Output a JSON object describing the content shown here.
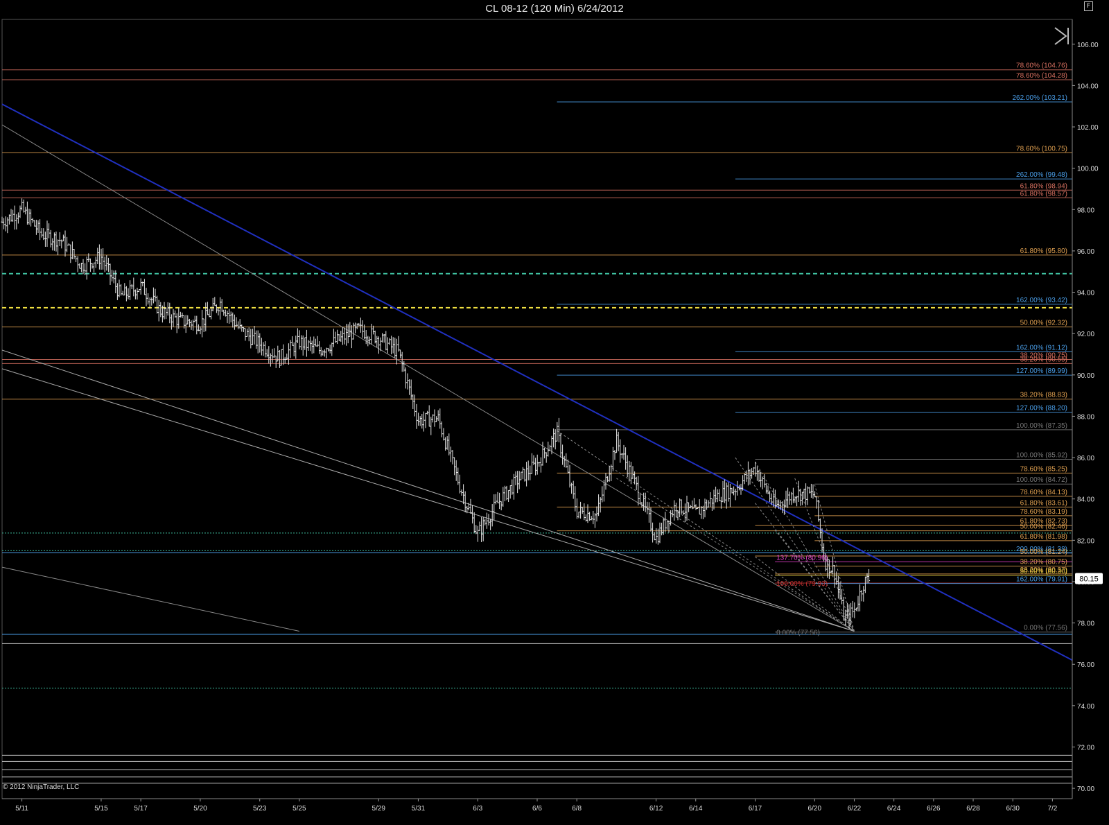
{
  "window": {
    "title": "CL 08-12 (120 Min)  6/24/2012",
    "f_button": "F"
  },
  "copyright": "© 2012 NinjaTrader, LLC",
  "chart_data": {
    "type": "ohlc_bar",
    "instrument": "CL 08-12",
    "interval": "120 Min",
    "ylim": [
      69.5,
      107.2
    ],
    "y_ticks": [
      106,
      104,
      102,
      100,
      98,
      96,
      94,
      92,
      90,
      88,
      86,
      84,
      82,
      80,
      78,
      76,
      74,
      72,
      70
    ],
    "y_tick_labels": [
      "106.00",
      "104.00",
      "102.00",
      "100.00",
      "98.00",
      "96.00",
      "94.00",
      "92.00",
      "90.00",
      "88.00",
      "86.00",
      "84.00",
      "82.00",
      "80.00",
      "78.00",
      "76.00",
      "74.00",
      "72.00",
      "70.00"
    ],
    "x_range": [
      "5/10",
      "7/3"
    ],
    "x_tick_dates": [
      "5/11",
      "5/15",
      "5/17",
      "5/20",
      "5/23",
      "5/25",
      "5/29",
      "5/31",
      "6/3",
      "6/6",
      "6/8",
      "6/12",
      "6/14",
      "6/17",
      "6/20",
      "6/22",
      "6/24",
      "6/26",
      "6/28",
      "6/30",
      "7/2"
    ],
    "x_tick_labels": [
      "5/11",
      "5/15",
      "5/17",
      "5/20",
      "5/23",
      "5/25",
      "5/29",
      "5/31",
      "6/3",
      "6/6",
      "6/8",
      "6/12",
      "6/14",
      "6/17",
      "6/20",
      "6/22",
      "6/24",
      "6/26",
      "6/28",
      "6/30",
      "7/2"
    ],
    "last_price": "80.15",
    "price_path": [
      [
        "5/10",
        97.4
      ],
      [
        "5/11",
        98.0
      ],
      [
        "5/12",
        96.8
      ],
      [
        "5/13",
        96.5
      ],
      [
        "5/14",
        95.3
      ],
      [
        "5/15",
        95.7
      ],
      [
        "5/16",
        93.8
      ],
      [
        "5/17",
        94.3
      ],
      [
        "5/18",
        93.1
      ],
      [
        "5/19",
        92.6
      ],
      [
        "5/20",
        92.5
      ],
      [
        "5/21",
        93.5
      ],
      [
        "5/22",
        92.2
      ],
      [
        "5/23",
        91.5
      ],
      [
        "5/24",
        90.8
      ],
      [
        "5/25",
        91.6
      ],
      [
        "5/26",
        91.2
      ],
      [
        "5/27",
        91.7
      ],
      [
        "5/28",
        92.2
      ],
      [
        "5/29",
        91.8
      ],
      [
        "5/30",
        91.1
      ],
      [
        "5/31",
        87.8
      ],
      [
        "6/1",
        87.9
      ],
      [
        "6/2",
        84.9
      ],
      [
        "6/3",
        82.3
      ],
      [
        "6/4",
        83.8
      ],
      [
        "6/5",
        84.9
      ],
      [
        "6/6",
        85.7
      ],
      [
        "6/7",
        87.2
      ],
      [
        "6/8",
        83.4
      ],
      [
        "6/9",
        83.2
      ],
      [
        "6/10",
        86.8
      ],
      [
        "6/11",
        84.6
      ],
      [
        "6/12",
        82.1
      ],
      [
        "6/13",
        83.7
      ],
      [
        "6/14",
        83.3
      ],
      [
        "6/15",
        84.1
      ],
      [
        "6/16",
        84.5
      ],
      [
        "6/17",
        85.5
      ],
      [
        "6/18",
        83.6
      ],
      [
        "6/19",
        84.3
      ],
      [
        "6/20",
        84.2
      ],
      [
        "6/20.5",
        81.0
      ],
      [
        "6/21",
        80.5
      ],
      [
        "6/21.5",
        78.2
      ],
      [
        "6/22",
        78.6
      ],
      [
        "6/22.5",
        80.0
      ],
      [
        "6/22.8",
        80.15
      ]
    ],
    "fib_levels": [
      {
        "label": "78.60% (104.76)",
        "price": 104.76,
        "color": "#d77060",
        "start": "left"
      },
      {
        "label": "78.60% (104.28)",
        "price": 104.28,
        "color": "#d77060",
        "start": "left"
      },
      {
        "label": "262.00% (103.21)",
        "price": 103.21,
        "color": "#4a9ee8",
        "start": "6/7"
      },
      {
        "label": "78.60% (100.75)",
        "price": 100.75,
        "color": "#e0a050",
        "start": "left"
      },
      {
        "label": "262.00% (99.48)",
        "price": 99.48,
        "color": "#4a9ee8",
        "start": "6/16"
      },
      {
        "label": "61.80% (98.94)",
        "price": 98.94,
        "color": "#d77060",
        "start": "left"
      },
      {
        "label": "61.80% (98.57)",
        "price": 98.57,
        "color": "#d77060",
        "start": "left"
      },
      {
        "label": "61.80% (95.80)",
        "price": 95.8,
        "color": "#e0a050",
        "start": "left"
      },
      {
        "label": "162.00% (93.42)",
        "price": 93.42,
        "color": "#4a9ee8",
        "start": "6/7"
      },
      {
        "label": "50.00% (92.32)",
        "price": 92.32,
        "color": "#e0a050",
        "start": "left"
      },
      {
        "label": "162.00% (91.12)",
        "price": 91.12,
        "color": "#4a9ee8",
        "start": "6/16"
      },
      {
        "label": "38.20% (90.75)",
        "price": 90.75,
        "color": "#d77060",
        "start": "left"
      },
      {
        "label": "38.20% (90.55)",
        "price": 90.55,
        "color": "#d77060",
        "start": "left"
      },
      {
        "label": "127.00% (89.99)",
        "price": 89.99,
        "color": "#4a9ee8",
        "start": "6/7"
      },
      {
        "label": "38.20% (88.83)",
        "price": 88.83,
        "color": "#e0a050",
        "start": "left"
      },
      {
        "label": "127.00% (88.20)",
        "price": 88.2,
        "color": "#4a9ee8",
        "start": "6/16"
      },
      {
        "label": "100.00% (87.35)",
        "price": 87.35,
        "color": "#777777",
        "start": "6/7"
      },
      {
        "label": "100.00% (85.92)",
        "price": 85.92,
        "color": "#777777",
        "start": "6/17"
      },
      {
        "label": "78.60% (85.25)",
        "price": 85.25,
        "color": "#e0a050",
        "start": "6/7"
      },
      {
        "label": "100.00% (84.72)",
        "price": 84.72,
        "color": "#777777",
        "start": "6/20"
      },
      {
        "label": "78.60% (84.13)",
        "price": 84.13,
        "color": "#e0a050",
        "start": "6/20"
      },
      {
        "label": "61.80% (83.61)",
        "price": 83.61,
        "color": "#e0a050",
        "start": "6/7"
      },
      {
        "label": "78.60% (83.19)",
        "price": 83.19,
        "color": "#e0a050",
        "start": "6/20"
      },
      {
        "label": "61.80% (82.73)",
        "price": 82.73,
        "color": "#e0a050",
        "start": "6/17"
      },
      {
        "label": "50.00% (82.46)",
        "price": 82.46,
        "color": "#e0a050",
        "start": "6/7"
      },
      {
        "label": "61.80% (81.98)",
        "price": 81.98,
        "color": "#e0a050",
        "start": "6/20"
      },
      {
        "label": "200.00% (81.38)",
        "price": 81.38,
        "color": "#4a9ee8",
        "start": "6/21"
      },
      {
        "label": "50.00% (81.24)",
        "price": 81.24,
        "color": "#e0a050",
        "start": "6/17"
      },
      {
        "label": "137.70% (80.96)",
        "price": 80.96,
        "color": "#e040c8",
        "start": "6/18"
      },
      {
        "label": "38.20% (80.75)",
        "price": 80.75,
        "color": "#e0a050",
        "start": "6/20"
      },
      {
        "label": "38.20% (80.37)",
        "price": 80.37,
        "color": "#e0a050",
        "start": "6/18"
      },
      {
        "label": "50.00% (80.30)",
        "price": 80.3,
        "color": "#e8d040",
        "start": "6/18"
      },
      {
        "label": "100.00% (79.93)",
        "price": 79.93,
        "color": "#c03030",
        "start": "6/18"
      },
      {
        "label": "162.00% (79.91)",
        "price": 79.91,
        "color": "#4a9ee8",
        "start": "6/20"
      },
      {
        "label": "0.00% (77.56)",
        "price": 77.56,
        "color": "#777777",
        "start": "6/18"
      },
      {
        "label": "0.00% (77.56)",
        "price": 77.56,
        "color": "#777777",
        "start": "right-only"
      }
    ],
    "horizontal_lines": [
      {
        "price": 94.9,
        "color": "#3fc0a0",
        "style": "dashed"
      },
      {
        "price": 93.25,
        "color": "#f0e040",
        "style": "dashed"
      },
      {
        "price": 82.35,
        "color": "#3fc0a0",
        "style": "dotted"
      },
      {
        "price": 81.5,
        "color": "#3fc0a0",
        "style": "dotted"
      },
      {
        "price": 81.4,
        "color": "#4a9ee8",
        "style": "solid"
      },
      {
        "price": 77.45,
        "color": "#4a9ee8",
        "style": "solid"
      },
      {
        "price": 77.0,
        "color": "#cccccc",
        "style": "solid"
      },
      {
        "price": 74.85,
        "color": "#3fc0a0",
        "style": "dotted"
      },
      {
        "price": 71.6,
        "color": "#cccccc",
        "style": "solid"
      },
      {
        "price": 71.3,
        "color": "#cccccc",
        "style": "solid"
      },
      {
        "price": 70.9,
        "color": "#cccccc",
        "style": "solid"
      },
      {
        "price": 70.55,
        "color": "#cccccc",
        "style": "solid"
      },
      {
        "price": 70.25,
        "color": "#cccccc",
        "style": "solid"
      }
    ],
    "trend_lines": [
      {
        "from": [
          "5/10",
          103.1
        ],
        "to": [
          "7/3",
          76.2
        ],
        "color": "#2030c0",
        "width": 2
      },
      {
        "from": [
          "5/10",
          102.1
        ],
        "to": [
          "6/22",
          77.6
        ],
        "color": "#888888",
        "width": 1
      },
      {
        "from": [
          "5/10",
          91.2
        ],
        "to": [
          "6/22",
          77.6
        ],
        "color": "#aaaaaa",
        "width": 1
      },
      {
        "from": [
          "5/10",
          90.3
        ],
        "to": [
          "6/22",
          77.6
        ],
        "color": "#aaaaaa",
        "width": 1
      },
      {
        "from": [
          "5/10",
          80.7
        ],
        "to": [
          "5/25",
          77.6
        ],
        "color": "#888888",
        "width": 1
      },
      {
        "from": [
          "6/7",
          87.3
        ],
        "to": [
          "6/22",
          77.6
        ],
        "color": "#888888",
        "width": 1,
        "style": "dashed"
      },
      {
        "from": [
          "6/16",
          86.0
        ],
        "to": [
          "6/22",
          77.6
        ],
        "color": "#888888",
        "width": 1,
        "style": "dashed"
      },
      {
        "from": [
          "6/17",
          85.8
        ],
        "to": [
          "6/22",
          77.6
        ],
        "color": "#888888",
        "width": 1,
        "style": "dashed"
      },
      {
        "from": [
          "6/20",
          84.7
        ],
        "to": [
          "6/22",
          77.6
        ],
        "color": "#888888",
        "width": 1,
        "style": "dashed"
      },
      {
        "from": [
          "6/10",
          85.0
        ],
        "to": [
          "6/22",
          77.6
        ],
        "color": "#888888",
        "width": 1,
        "style": "dashed"
      },
      {
        "from": [
          "6/19",
          85.0
        ],
        "to": [
          "6/22",
          77.6
        ],
        "color": "#888888",
        "width": 1,
        "style": "dashed"
      },
      {
        "from": [
          "6/17",
          83.8
        ],
        "to": [
          "6/22",
          77.6
        ],
        "color": "#888888",
        "width": 1,
        "style": "dashed"
      },
      {
        "from": [
          "6/18",
          82.5
        ],
        "to": [
          "6/22",
          77.6
        ],
        "color": "#888888",
        "width": 1,
        "style": "dashed"
      },
      {
        "from": [
          "6/17",
          81.2
        ],
        "to": [
          "6/22",
          77.6
        ],
        "color": "#888888",
        "width": 1,
        "style": "dashed"
      }
    ]
  }
}
